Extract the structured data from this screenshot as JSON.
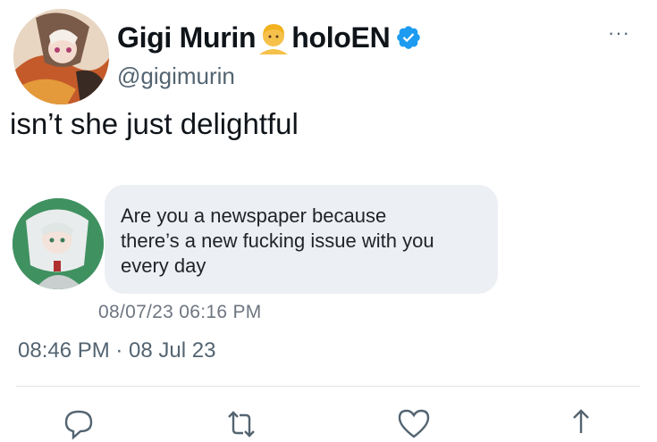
{
  "tweet": {
    "display_name": "Gigi Murin",
    "name_suffix": "holoEN",
    "name_emoji": "person-emoji-icon",
    "verified_icon": "verified-badge-icon",
    "handle": "@gigimurin",
    "more_label": "···",
    "text": "isn’t she just delightful",
    "timestamp": "08:46 PM · 08 Jul 23"
  },
  "embedded_message": {
    "text": "Are you a newspaper because\nthere’s a new fucking issue with you\nevery day",
    "time": "08/07/23  06:16 PM"
  },
  "actions": [
    "reply-icon",
    "retweet-icon",
    "like-icon",
    "share-icon"
  ],
  "colors": {
    "verified": "#1d9bf0",
    "secondary_text": "#536471",
    "bubble": "#eceff3"
  }
}
